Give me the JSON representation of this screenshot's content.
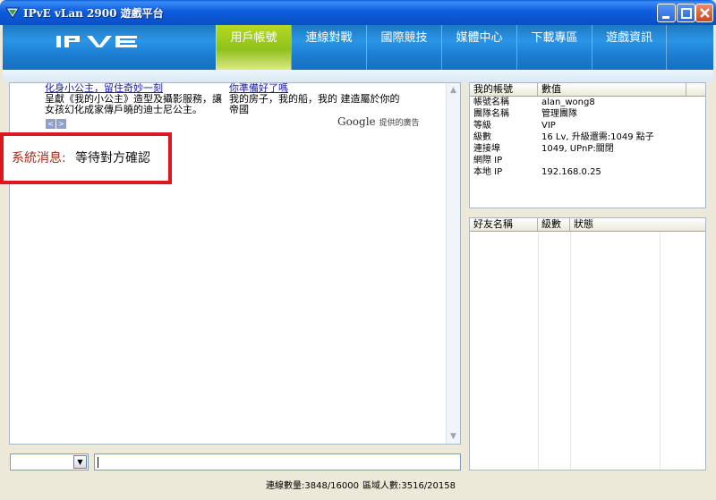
{
  "window": {
    "title": "IPvE vLan 2900 遊戲平台"
  },
  "nav": [
    "用戶帳號",
    "連線對戰",
    "國際競技",
    "媒體中心",
    "下載專區",
    "遊戲資訊"
  ],
  "ads": [
    {
      "title": "化身小公主，留住奇妙一刻",
      "text": "呈獻《我的小公主》造型及攝影服務，讓女孩幻化成家傳戶曉的迪士尼公主。"
    },
    {
      "title": "你準備好了嗎",
      "text": "我的房子，我的船，我的 建造屬於你的帝國"
    }
  ],
  "ad_nav": {
    "prev": "<",
    "next": ">"
  },
  "google": {
    "brand": "Google",
    "caption": "提供的廣告"
  },
  "system_message": {
    "label": "系統消息:",
    "text": "等待對方確認"
  },
  "account_table": {
    "headers": [
      "我的帳號",
      "數值"
    ],
    "rows": [
      [
        "帳號名稱",
        "alan_wong8"
      ],
      [
        "團隊名稱",
        "管理團隊"
      ],
      [
        "等級",
        "VIP"
      ],
      [
        "級數",
        "16 Lv, 升級還需:1049 點子"
      ],
      [
        "連接埠",
        "1049, UPnP:關閉"
      ],
      [
        "網際 IP",
        ""
      ],
      [
        "本地 IP",
        "192.168.0.25"
      ]
    ]
  },
  "friends_table": {
    "headers": [
      "好友名稱",
      "級數",
      "狀態"
    ]
  },
  "status_bar": {
    "connections": "連線數量:3848/16000",
    "region_users": "區域人數:3516/20158"
  },
  "colors": {
    "nav_active": "#9cc81c",
    "header": "#2288d8",
    "message_border": "#e0161e"
  }
}
